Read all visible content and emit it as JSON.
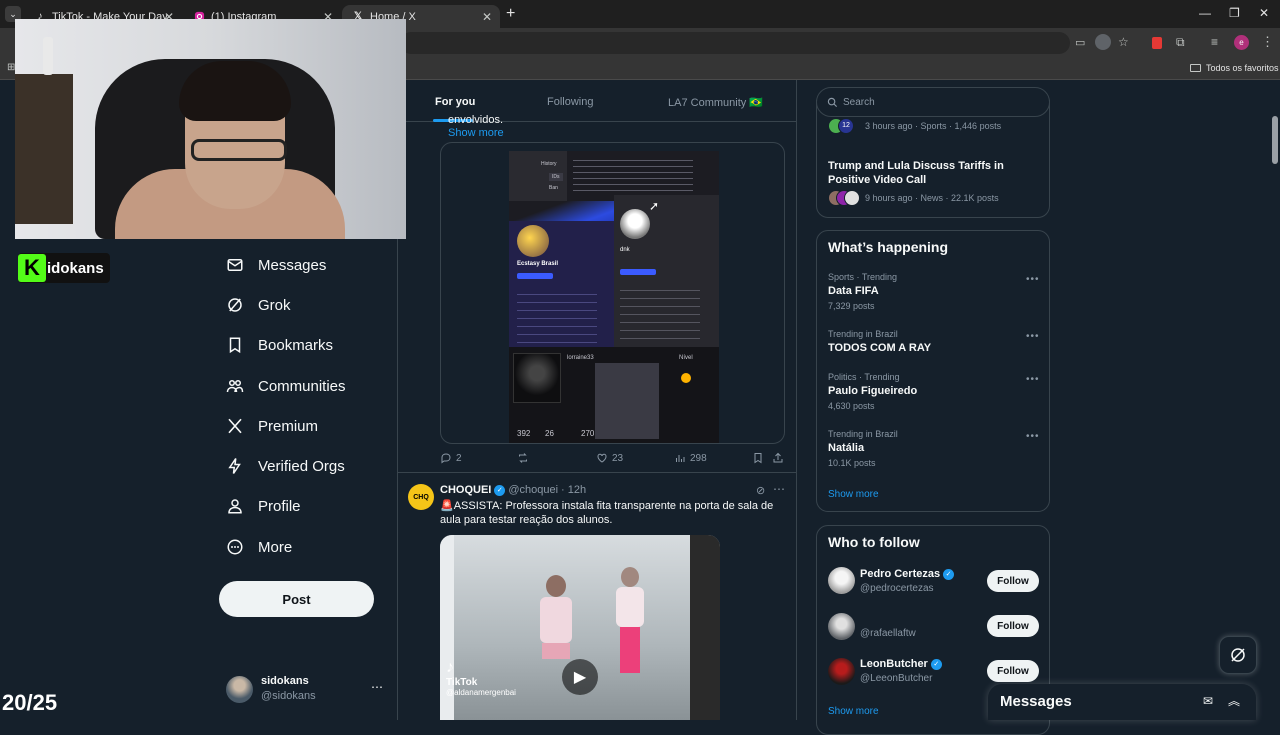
{
  "browser": {
    "tabs": [
      {
        "title": "TikTok - Make Your Day",
        "icon": "tiktok-icon"
      },
      {
        "title": "(1) Instagram",
        "icon": "instagram-icon"
      },
      {
        "title": "Home / X",
        "icon": "x-logo-icon"
      }
    ],
    "bookmarks_label": "Todos os favoritos"
  },
  "overlay": {
    "streamer_label": "idokans",
    "counter": "20/25"
  },
  "nav": {
    "items": [
      {
        "label": "Messages",
        "icon": "envelope-icon"
      },
      {
        "label": "Grok",
        "icon": "grok-icon"
      },
      {
        "label": "Bookmarks",
        "icon": "bookmark-icon"
      },
      {
        "label": "Communities",
        "icon": "communities-icon"
      },
      {
        "label": "Premium",
        "icon": "x-logo-icon"
      },
      {
        "label": "Verified Orgs",
        "icon": "lightning-icon"
      },
      {
        "label": "Profile",
        "icon": "person-icon"
      },
      {
        "label": "More",
        "icon": "more-circle-icon"
      }
    ],
    "post_button": "Post",
    "account": {
      "name": "sidokans",
      "handle": "@sidokans"
    }
  },
  "feed": {
    "tabs": [
      "For you",
      "Following",
      "LA7 Community 🇧🇷"
    ],
    "post1": {
      "truncated_text": "envolvidos.",
      "show_more": "Show more",
      "replies": "2",
      "reposts": "",
      "likes": "23",
      "views": "298",
      "image_texts": {
        "menu": [
          "History",
          "IDs",
          "Ban"
        ],
        "user_left": "Ecstasy Brasil",
        "user_right": "dnk",
        "bottom_left": "lorraine33",
        "bottom_right": "Nível",
        "stats": [
          "392",
          "26",
          "270"
        ]
      }
    },
    "post2": {
      "author": "CHOQUEI",
      "handle": "@choquei",
      "time": "12h",
      "text": "🚨ASSISTA: Professora instala fita transparente na porta de sala de aula para testar reação dos alunos.",
      "video_watermark": "TikTok",
      "video_user": "@aldanamergenbai"
    }
  },
  "sidebar": {
    "search_placeholder": "Search",
    "top_news": [
      {
        "meta": "3 hours ago · Sports · 1,446 posts"
      },
      {
        "title": "Trump and Lula Discuss Tariffs in Positive Video Call",
        "meta": "9 hours ago · News · 22.1K posts"
      }
    ],
    "whats_happening": {
      "title": "What’s happening",
      "trends": [
        {
          "category": "Sports · Trending",
          "name": "Data FIFA",
          "count": "7,329 posts"
        },
        {
          "category": "Trending in Brazil",
          "name": "TODOS COM A RAY",
          "count": ""
        },
        {
          "category": "Politics · Trending",
          "name": "Paulo Figueiredo",
          "count": "4,630 posts"
        },
        {
          "category": "Trending in Brazil",
          "name": "Natália",
          "count": "10.1K posts"
        }
      ],
      "show_more": "Show more"
    },
    "who_to_follow": {
      "title": "Who to follow",
      "accounts": [
        {
          "name": "Pedro Certezas",
          "handle": "@pedrocertezas",
          "verified": true
        },
        {
          "name": "",
          "handle": "@rafaellaftw",
          "verified": false
        },
        {
          "name": "LeonButcher",
          "handle": "@LeeonButcher",
          "verified": true
        }
      ],
      "follow_label": "Follow",
      "show_more": "Show more"
    },
    "messages_drawer": "Messages"
  },
  "colors": {
    "background": "#15202b",
    "border": "#38444d",
    "accent": "#1d9bf0",
    "muted": "#8b98a5"
  }
}
